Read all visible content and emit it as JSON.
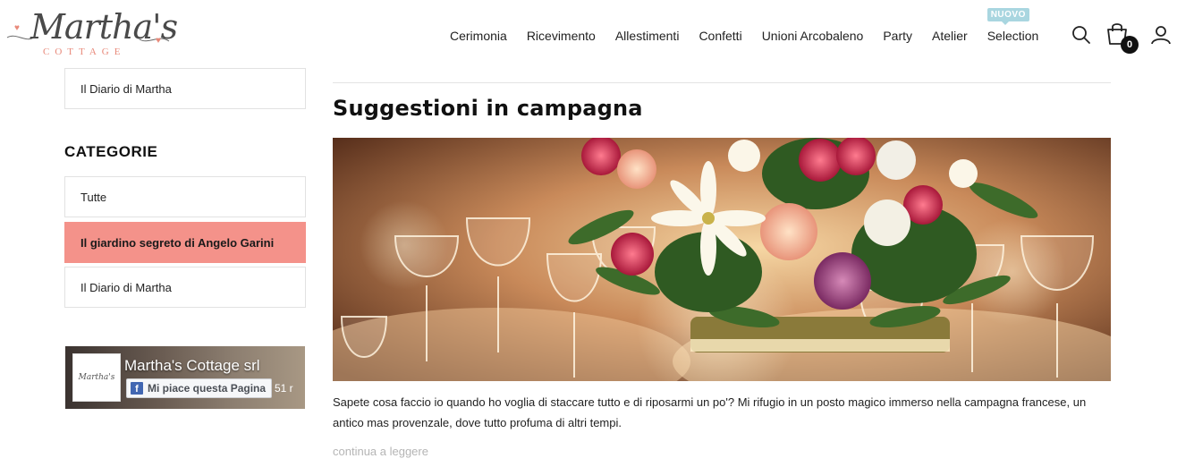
{
  "brand": {
    "name": "Martha's",
    "subtitle": "COTTAGE"
  },
  "nav": {
    "items": [
      "Cerimonia",
      "Ricevimento",
      "Allestimenti",
      "Confetti",
      "Unioni Arcobaleno",
      "Party",
      "Atelier",
      "Selection"
    ],
    "new_badge": "NUOVO"
  },
  "header": {
    "cart_count": "0",
    "icons": [
      "search-icon",
      "shopping-bag-icon",
      "user-icon"
    ]
  },
  "sidebar": {
    "top_item": "Il Diario di Martha",
    "categories_heading": "CATEGORIE",
    "categories": [
      {
        "label": "Tutte",
        "active": false
      },
      {
        "label": "Il giardino segreto di Angelo Garini",
        "active": true
      },
      {
        "label": "Il Diario di Martha",
        "active": false
      }
    ],
    "facebook": {
      "page_name": "Martha's Cottage srl",
      "like_label": "Mi piace questa Pagina",
      "like_count": "51 r",
      "thumb_text": "Martha's"
    }
  },
  "post": {
    "title": "Suggestioni in campagna",
    "excerpt": "Sapete cosa faccio io quando ho voglia di staccare tutto e di riposarmi un po'? Mi rifugio in un posto magico immerso nella campagna francese, un antico mas provenzale, dove tutto profuma di altri tempi.",
    "read_more": "continua a leggere"
  },
  "colors": {
    "accent": "#f4928a",
    "badge": "#a9d6e0",
    "logo_pink": "#e8897a",
    "facebook_blue": "#4267b2"
  }
}
